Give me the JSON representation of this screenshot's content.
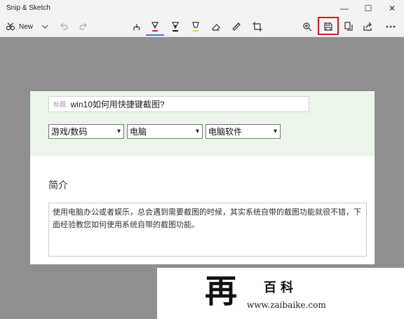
{
  "app": {
    "title": "Snip & Sketch"
  },
  "window_controls": {
    "minimize": "—",
    "maximize": "☐",
    "close": "✕"
  },
  "toolbar": {
    "new_label": "New",
    "tools": [
      "new",
      "undo",
      "redo",
      "touch-writing",
      "ballpoint-pen",
      "pencil",
      "highlighter",
      "eraser",
      "ruler",
      "crop",
      "zoom",
      "save",
      "copy",
      "share",
      "more"
    ],
    "active_tool": "ballpoint-pen",
    "highlighted_tool": "save",
    "colors": {
      "pen": "#d32626",
      "pencil": "#1a1a1a",
      "highlighter": "#f2d32a",
      "accent": "#3a7bd5",
      "highlight_box": "#cc1f1f"
    }
  },
  "content": {
    "title_placeholder": "标题:",
    "title_value": "win10如何用快捷键截图?",
    "selects": [
      {
        "value": "游戏/数码"
      },
      {
        "value": "电脑"
      },
      {
        "value": "电脑软件"
      }
    ],
    "section_heading": "简介",
    "intro_text": "使用电脑办公或者娱乐，总会遇到需要截图的时候，其实系统自带的截图功能就很不错，下面经验教您如何使用系统自带的截图功能。"
  },
  "watermark": {
    "logo_glyph": "再",
    "brand": "百科",
    "url": "www.zaibaike.com"
  }
}
